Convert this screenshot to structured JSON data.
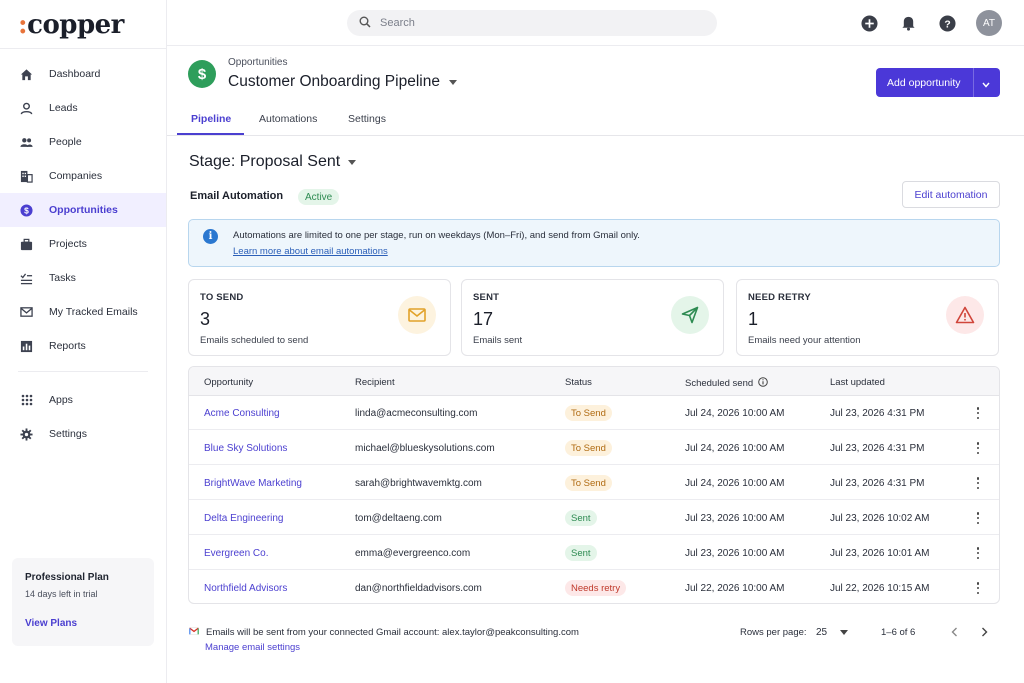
{
  "brand": {
    "name": "copper",
    "dots": ":"
  },
  "search": {
    "placeholder": "Search"
  },
  "user": {
    "initials": "AT"
  },
  "sidebar": {
    "items": [
      {
        "label": "Dashboard",
        "icon": "home-icon"
      },
      {
        "label": "Leads",
        "icon": "person-icon"
      },
      {
        "label": "People",
        "icon": "people-icon"
      },
      {
        "label": "Companies",
        "icon": "building-icon"
      },
      {
        "label": "Opportunities",
        "icon": "dollar-icon",
        "active": true
      },
      {
        "label": "Projects",
        "icon": "briefcase-icon"
      },
      {
        "label": "Tasks",
        "icon": "tasks-icon"
      },
      {
        "label": "My Tracked Emails",
        "icon": "mail-icon"
      },
      {
        "label": "Reports",
        "icon": "bar-chart-icon"
      }
    ],
    "secondary": [
      {
        "label": "Apps",
        "icon": "grid-icon"
      },
      {
        "label": "Settings",
        "icon": "gear-icon"
      }
    ],
    "plan": {
      "title": "Professional Plan",
      "subtitle": "14 days left in trial",
      "link": "View Plans"
    }
  },
  "header": {
    "breadcrumb": "Opportunities",
    "title": "Customer Onboarding Pipeline",
    "add_button": "Add opportunity"
  },
  "tabs": [
    {
      "label": "Pipeline",
      "active": true
    },
    {
      "label": "Automations"
    },
    {
      "label": "Settings"
    }
  ],
  "stage": {
    "label": "Stage: Proposal Sent"
  },
  "automation": {
    "title": "Email Automation",
    "status": "Active",
    "edit_button": "Edit automation",
    "info_text": "Automations are limited to one per stage, run on weekdays (Mon–Fri), and send from Gmail only.",
    "info_link": "Learn more about email automations"
  },
  "stats": [
    {
      "label": "TO SEND",
      "value": "3",
      "desc": "Emails scheduled to send",
      "icon": "mail-icon",
      "color": "#e2a22a",
      "bg": "#fdf3df"
    },
    {
      "label": "SENT",
      "value": "17",
      "desc": "Emails sent",
      "icon": "send-icon",
      "color": "#2e8b52",
      "bg": "#e4f5e9"
    },
    {
      "label": "NEED RETRY",
      "value": "1",
      "desc": "Emails need your attention",
      "icon": "warning-icon",
      "color": "#d0453a",
      "bg": "#fde8e8"
    }
  ],
  "table": {
    "columns": [
      "Opportunity",
      "Recipient",
      "Status",
      "Scheduled send",
      "Last updated"
    ],
    "rows": [
      {
        "opportunity": "Acme Consulting",
        "recipient": "linda@acmeconsulting.com",
        "status": "To Send",
        "scheduled": "Jul 24, 2026 10:00 AM",
        "updated": "Jul 23, 2026 4:31 PM"
      },
      {
        "opportunity": "Blue Sky Solutions",
        "recipient": "michael@blueskysolutions.com",
        "status": "To Send",
        "scheduled": "Jul 24, 2026 10:00 AM",
        "updated": "Jul 23, 2026 4:31 PM"
      },
      {
        "opportunity": "BrightWave Marketing",
        "recipient": "sarah@brightwavemktg.com",
        "status": "To Send",
        "scheduled": "Jul 24, 2026 10:00 AM",
        "updated": "Jul 23, 2026 4:31 PM"
      },
      {
        "opportunity": "Delta Engineering",
        "recipient": "tom@deltaeng.com",
        "status": "Sent",
        "scheduled": "Jul 23, 2026 10:00 AM",
        "updated": "Jul 23, 2026 10:02 AM"
      },
      {
        "opportunity": "Evergreen Co.",
        "recipient": "emma@evergreenco.com",
        "status": "Sent",
        "scheduled": "Jul 23, 2026 10:00 AM",
        "updated": "Jul 23, 2026 10:01 AM"
      },
      {
        "opportunity": "Northfield Advisors",
        "recipient": "dan@northfieldadvisors.com",
        "status": "Needs retry",
        "scheduled": "Jul 22, 2026 10:00 AM",
        "updated": "Jul 22, 2026 10:15 AM"
      }
    ]
  },
  "footer": {
    "gmail_text": "Emails will be sent from your connected Gmail account: alex.taylor@peakconsulting.com",
    "gmail_link": "Manage email settings",
    "rows_per_page_label": "Rows per page:",
    "rows_per_page": "25",
    "range": "1–6 of 6"
  }
}
